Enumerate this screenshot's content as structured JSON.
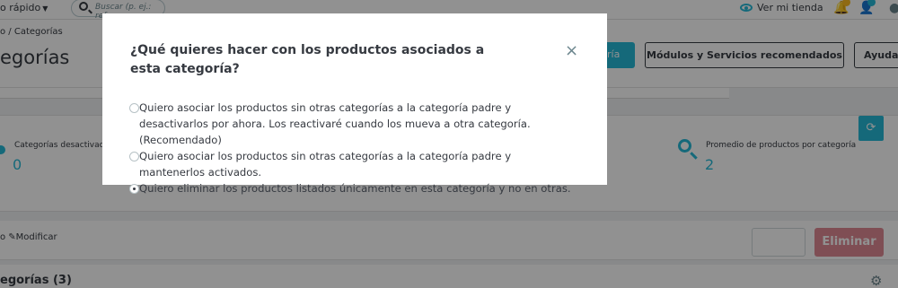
{
  "topbar": {
    "quick_access": "o rápido",
    "search_placeholder": "Buscar (p. ej.: ref",
    "store_link": "Ver mi tienda"
  },
  "header": {
    "breadcrumb": "o  /  Categorías",
    "title": "egorías",
    "add_button": "ría",
    "modules_button": "Módulos y Servicios recomendados",
    "help_button": "Ayuda"
  },
  "kpi": {
    "disabled_label": "Categorías desactivad",
    "disabled_value": "0",
    "avg_label": "Promedio de productos por categoría",
    "avg_value": "2"
  },
  "bulk": {
    "edit_label": "o ✎Modificar",
    "delete_label": "Eliminar"
  },
  "list": {
    "title": "egorías (3)"
  },
  "modal": {
    "title": "¿Qué quieres hacer con los productos asociados a esta categoría?",
    "close": "×",
    "options": [
      {
        "label": "Quiero asociar los productos sin otras categorías a la categoría padre y desactivarlos por ahora. Los reactivaré cuando los mueva a otra categoría. (Recomendado)",
        "selected": false
      },
      {
        "label": "Quiero asociar los productos sin otras categorías a la categoría padre y mantenerlos activados.",
        "selected": false
      },
      {
        "label": "Quiero eliminar los productos listados únicamente en esta categoría y no en otras.",
        "selected": true
      }
    ]
  },
  "colors": {
    "accent": "#25b9d7",
    "danger": "#e08a95",
    "text": "#363a41"
  }
}
